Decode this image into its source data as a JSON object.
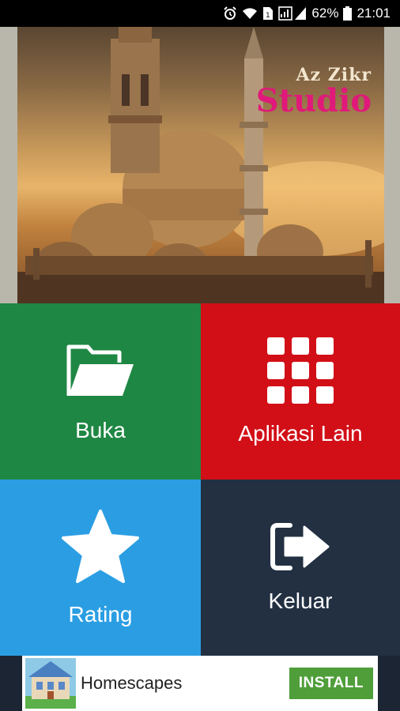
{
  "status_bar": {
    "battery_percent": "62%",
    "time": "21:01",
    "icons": [
      "alarm-icon",
      "wifi-icon",
      "sim-icon",
      "signal-icon",
      "battery-icon"
    ]
  },
  "banner": {
    "brand_line1": "Az Zikr",
    "brand_line2": "Studio"
  },
  "menu": {
    "open_label": "Buka",
    "other_apps_label": "Aplikasi Lain",
    "rating_label": "Rating",
    "exit_label": "Keluar"
  },
  "ad": {
    "app_name": "Homescapes",
    "install_label": "INSTALL"
  },
  "colors": {
    "open": "#1f8744",
    "other_apps": "#d20f17",
    "rating": "#2b9ee3",
    "exit": "#223042",
    "brand": "#e0197a",
    "install": "#4f9e3a"
  }
}
